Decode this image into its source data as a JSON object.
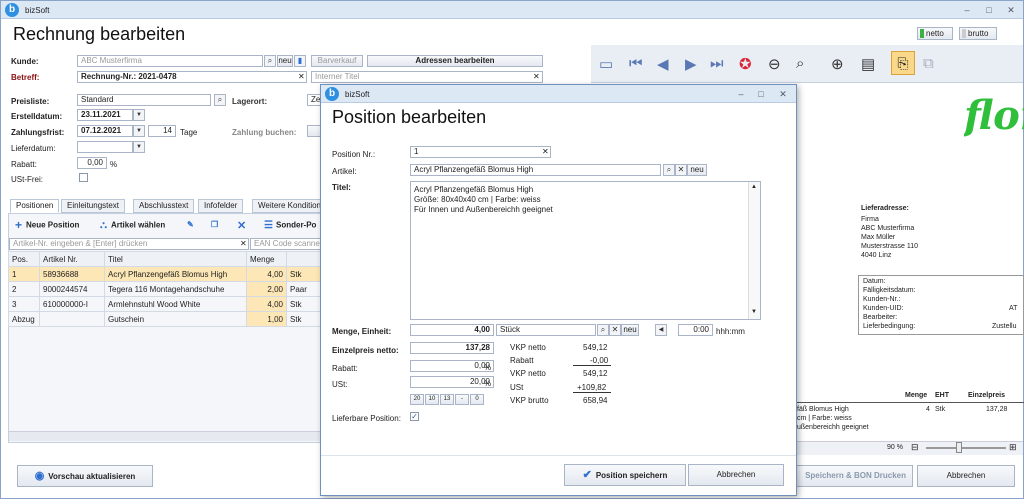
{
  "app": {
    "title": "bizSoft"
  },
  "main": {
    "title": "Rechnung bearbeiten",
    "toggles": {
      "netto": "netto",
      "brutto": "brutto"
    },
    "form": {
      "kunde_label": "Kunde:",
      "kunde_placeholder": "ABC Musterfirma",
      "neu": "neu",
      "barverkauf": "Barverkauf",
      "adressen": "Adressen bearbeiten",
      "betreff_label": "Betreff:",
      "betreff_value": "Rechnung-Nr.: 2021-0478",
      "interner_titel": "Interner Titel",
      "preisliste_label": "Preisliste:",
      "preisliste_value": "Standard",
      "lagerort_label": "Lagerort:",
      "lagerort_value": "Zen",
      "erstelldatum_label": "Erstelldatum:",
      "erstelldatum_value": "23.11.2021",
      "zahlungsfrist_label": "Zahlungsfrist:",
      "zahlungsfrist_value": "07.12.2021",
      "tage_value": "14",
      "tage_label": "Tage",
      "zahlung_buchen": "Zahlung buchen:",
      "lieferdatum_label": "Lieferdatum:",
      "rabatt_label": "Rabatt:",
      "rabatt_value": "0,00",
      "rabatt_unit": "%",
      "ust_frei_label": "USt-Frei:"
    },
    "tabs": [
      "Positionen",
      "Einleitungstext",
      "Abschlusstext",
      "Infofelder",
      "Weitere Konditionen"
    ],
    "toolbar": {
      "neue_position": "Neue Position",
      "artikel_waehlen": "Artikel wählen",
      "sonder": "Sonder-Po"
    },
    "search": {
      "artikel_placeholder": "Artikel-Nr. eingeben & [Enter] drücken",
      "ean_placeholder": "EAN Code scannen"
    },
    "table": {
      "headers": [
        "Pos.",
        "Artikel Nr.",
        "Titel",
        "Menge",
        ""
      ],
      "rows": [
        [
          "1",
          "58936688",
          "Acryl Pflanzengefäß Blomus High",
          "4,00",
          "Stk"
        ],
        [
          "2",
          "9000244574",
          "Tegera 116 Montagehandschuhe",
          "2,00",
          "Paar"
        ],
        [
          "3",
          "610000000-I",
          "Armlehnstuhl Wood White",
          "4,00",
          "Stk"
        ],
        [
          "Abzug",
          "",
          "Gutschein",
          "1,00",
          "Stk"
        ]
      ]
    },
    "vorschau_button": "Vorschau aktualisieren",
    "speichern_bon": "Speichern & BON Drucken",
    "abbrechen": "Abbrechen",
    "zoom": "90 %"
  },
  "preview": {
    "lieferadresse_label": "Lieferadresse:",
    "address": [
      "Firma",
      "ABC Musterfirma",
      "Max Müller",
      "Musterstrasse 110",
      "4040 Linz"
    ],
    "info_labels": [
      "Datum:",
      "Fälligkeitsdatum:",
      "Kunden-Nr.:",
      "Kunden-UID:",
      "Bearbeiter:",
      "Lieferbedingung:"
    ],
    "info_values": [
      "",
      "",
      "",
      "AT",
      "",
      "Zustellu"
    ],
    "col_headers": [
      "Menge",
      "EHT",
      "Einzelpreis"
    ],
    "row_text": [
      "fäß Blomus High",
      "cm | Farbe: weiss",
      "ußenbereichh geeignet"
    ],
    "row_menge": "4",
    "row_eht": "Stk",
    "row_preis": "137,28",
    "logo_text": "flora"
  },
  "dialog": {
    "app_title": "bizSoft",
    "title": "Position bearbeiten",
    "position_nr_label": "Position Nr.:",
    "position_nr_value": "1",
    "artikel_label": "Artikel:",
    "artikel_value": "Acryl Pflanzengefäß Blomus High",
    "neu": "neu",
    "titel_label": "Titel:",
    "titel_lines": [
      "Acryl Pflanzengefäß Blomus High",
      "Größe: 80x40x40 cm | Farbe: weiss",
      "Für Innen und Außenbereichh geeignet"
    ],
    "menge_label": "Menge, Einheit:",
    "menge_value": "4,00",
    "einheit_value": "Stück",
    "time_value": "0:00",
    "time_unit": "hhh:mm",
    "einzelpreis_label": "Einzelpreis netto:",
    "einzelpreis_value": "137,28",
    "rabatt_label": "Rabatt:",
    "rabatt_value": "0,00",
    "pct": "%",
    "ust_label": "USt:",
    "ust_value": "20,00",
    "ust_chips": [
      "20",
      "10",
      "13",
      "-",
      "0"
    ],
    "calc": [
      {
        "label": "VKP netto",
        "value": "549,12"
      },
      {
        "label": "Rabatt",
        "value": "-0,00"
      },
      {
        "label": "VKP netto",
        "value": "549,12"
      },
      {
        "label": "USt",
        "value": "+109,82"
      },
      {
        "label": "VKP brutto",
        "value": "658,94"
      }
    ],
    "lieferbare_label": "Lieferbare Position:",
    "speichern": "Position speichern",
    "abbrechen": "Abbrechen"
  },
  "colors": {
    "accent": "#2f8fe0",
    "selected_row": "#fde7b6",
    "logo_green": "#2fbf3a"
  }
}
